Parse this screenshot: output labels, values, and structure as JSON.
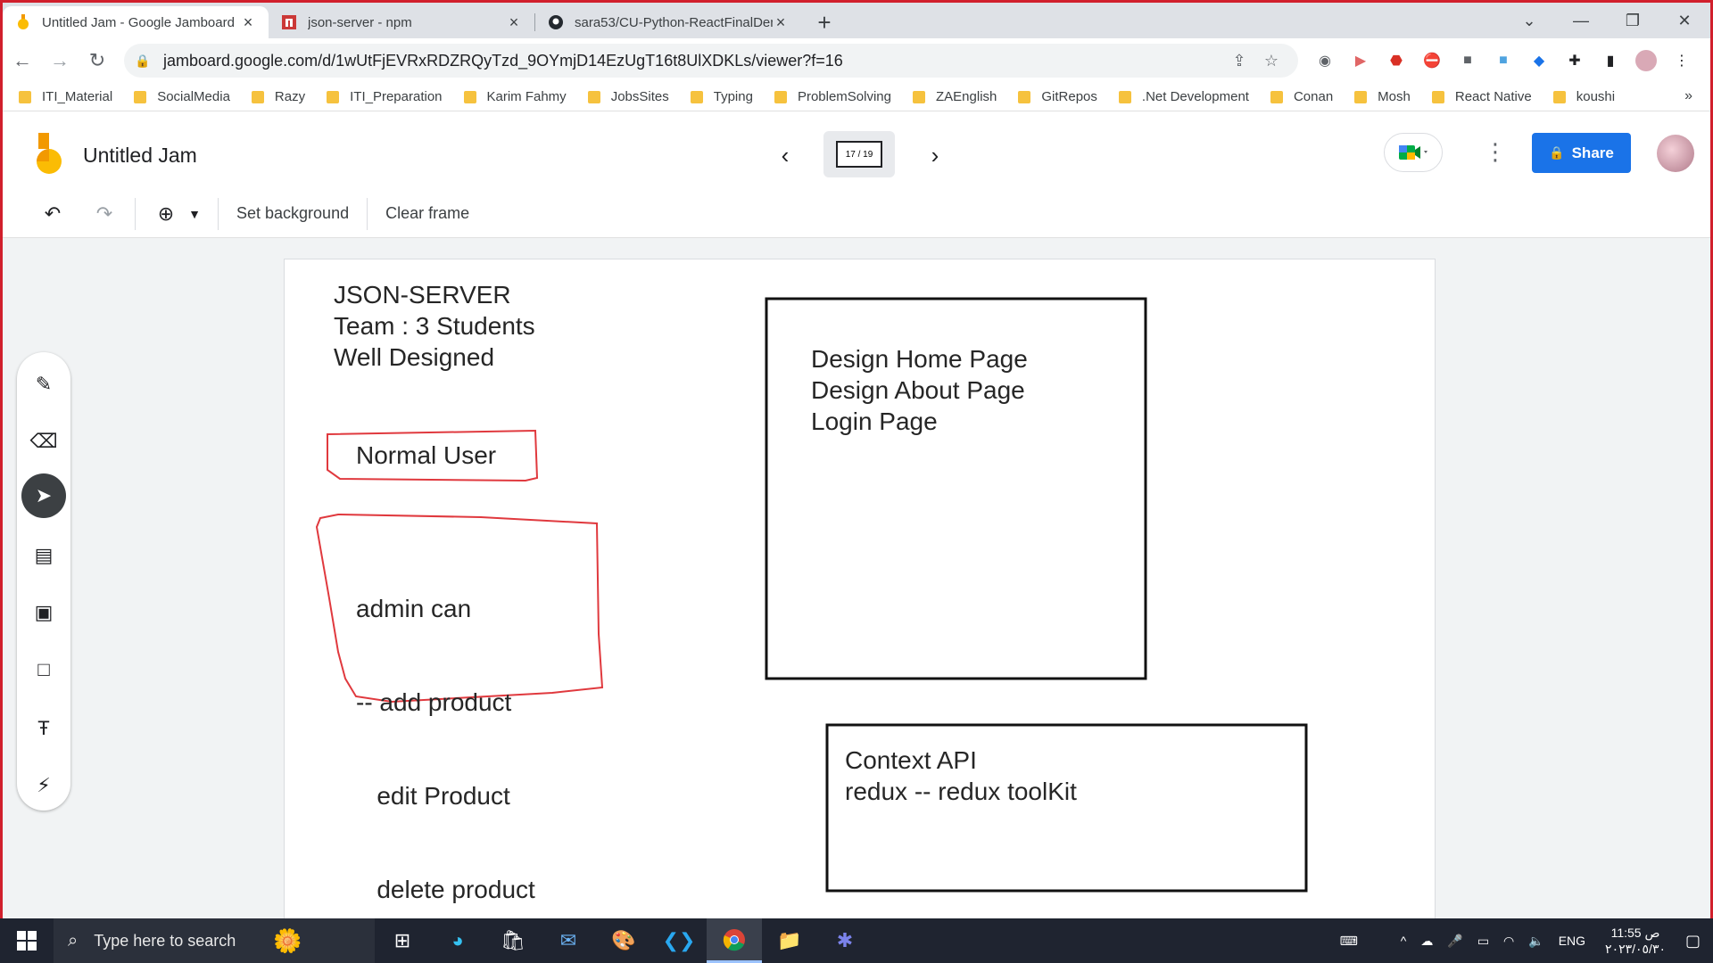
{
  "browser": {
    "tabs": [
      {
        "title": "Untitled Jam - Google Jamboard",
        "icon": "jamboard-icon"
      },
      {
        "title": "json-server - npm",
        "icon": "npm-icon"
      },
      {
        "title": "sara53/CU-Python-ReactFinalDem",
        "icon": "github-icon"
      }
    ],
    "url": "jamboard.google.com/d/1wUtFjEVRxRDZRQyTzd_9OYmjD14EzUgT16t8UlXDKLs/viewer?f=16",
    "bookmarks": [
      "ITI_Material",
      "SocialMedia",
      "Razy",
      "ITI_Preparation",
      "Karim Fahmy",
      "JobsSites",
      "Typing",
      "ProblemSolving",
      "ZAEnglish",
      "GitRepos",
      ".Net Development",
      "Conan",
      "Mosh",
      "React Native",
      "koushi"
    ]
  },
  "jam": {
    "title": "Untitled Jam",
    "frame_counter": "17 / 19",
    "share_label": "Share",
    "toolbar": {
      "set_background": "Set background",
      "clear_frame": "Clear frame"
    },
    "notes": {
      "header_lines": [
        "JSON-SERVER",
        "Team : 3 Students",
        "Well Designed"
      ],
      "normal_user": "Normal User",
      "admin_lines": [
        "admin can",
        "-- add product",
        "   edit Product",
        "   delete product"
      ],
      "pages_lines": [
        "Design Home Page",
        "Design About Page",
        "Login Page"
      ],
      "state_lines": [
        "Context API",
        "redux -- redux toolKit"
      ]
    },
    "colors": {
      "accent": "#1a73e8",
      "ink_red": "#e0393e",
      "ink_black": "#111111"
    }
  },
  "taskbar": {
    "search_placeholder": "Type here to search",
    "language": "ENG",
    "time": "11:55 ص",
    "date": "٢٠٢٣/٠٥/٣٠"
  }
}
